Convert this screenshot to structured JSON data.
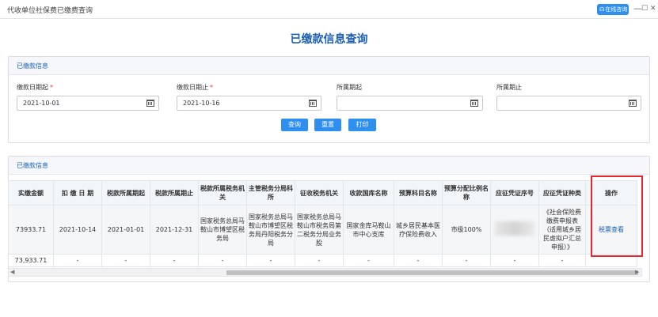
{
  "window": {
    "title": "代收单位社保费已缴费查询",
    "online_consult": "在线咨询",
    "min": "—",
    "max": "☐",
    "close": "✕"
  },
  "page_title": "已缴款信息查询",
  "query_panel": {
    "heading": "已缴款信息",
    "fields": [
      {
        "label": "缴款日期起",
        "required_mark": "*",
        "value": "2021-10-01"
      },
      {
        "label": "缴款日期止",
        "required_mark": "*",
        "value": "2021-10-16"
      },
      {
        "label": "所属期起",
        "value": ""
      },
      {
        "label": "所属期止",
        "value": ""
      }
    ],
    "buttons": {
      "query": "查询",
      "reset": "重置",
      "print": "打印"
    }
  },
  "result_panel": {
    "heading": "已缴款信息",
    "columns": [
      "实缴金额",
      "扣 缴 日 期",
      "税款所属期起",
      "税款所属期止",
      "税款所属税务机关",
      "主管税务分局科所",
      "征收税务机关",
      "收款国库名称",
      "预算科目名称",
      "预算分配比例名称",
      "应征凭证序号",
      "应征凭证种类",
      "操作"
    ],
    "rows": [
      {
        "amount": "73933.71",
        "deduct_date": "2021-10-14",
        "period_start": "2021-01-01",
        "period_end": "2021-12-31",
        "tax_office": "国家税务总局马鞍山市博望区税务局",
        "branch_office": "国家税务总局马鞍山市博望区税务局丹阳税务分局",
        "collect_office": "国家税务总局马鞍山市税务局第二税务分局业务股",
        "treasury": "国家金库马鞍山市中心支库",
        "budget_subject": "城乡居民基本医疗保险费收入",
        "ratio": "市级100%",
        "voucher_no": "",
        "voucher_type": "《社会保险费缴费申报表（适用城乡居民虚拟户汇总申报）》",
        "action": "税票查看"
      }
    ],
    "total_row": {
      "amount": "73,933.71",
      "placeholder": "-"
    }
  },
  "scrollbar": {
    "left_arrow": "◀",
    "right_arrow": "▶"
  }
}
